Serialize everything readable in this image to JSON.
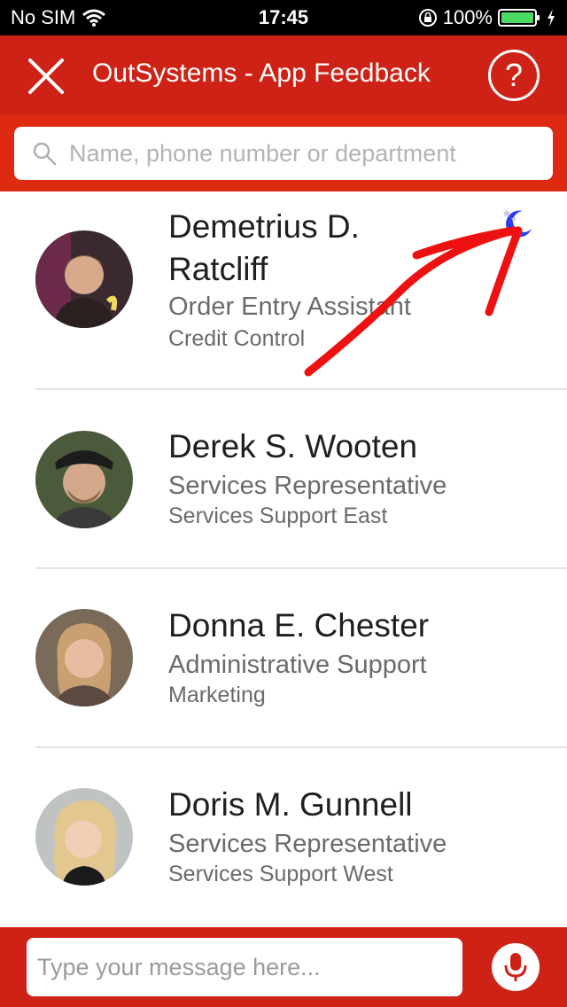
{
  "status_bar": {
    "carrier": "No SIM",
    "time": "17:45",
    "battery": "100%"
  },
  "header": {
    "title": "OutSystems - App Feedback",
    "help_label": "?"
  },
  "search": {
    "placeholder": "Name, phone number or department"
  },
  "contacts": [
    {
      "name_line1": "Demetrius D.",
      "name_line2": "Ratcliff",
      "role": "Order Entry Assistant",
      "department": "Credit Control"
    },
    {
      "name": "Derek S. Wooten",
      "role": "Services Representative",
      "department": "Services Support East"
    },
    {
      "name": "Donna E. Chester",
      "role": "Administrative Support",
      "department": "Marketing"
    },
    {
      "name": "Doris M. Gunnell",
      "role": "Services Representative",
      "department": "Services Support West"
    }
  ],
  "composer": {
    "placeholder": "Type your message here..."
  },
  "colors": {
    "header": "#cf2216",
    "search_band": "#de2a10",
    "annotation": "#ee1111",
    "moon": "#2f3bf0"
  }
}
